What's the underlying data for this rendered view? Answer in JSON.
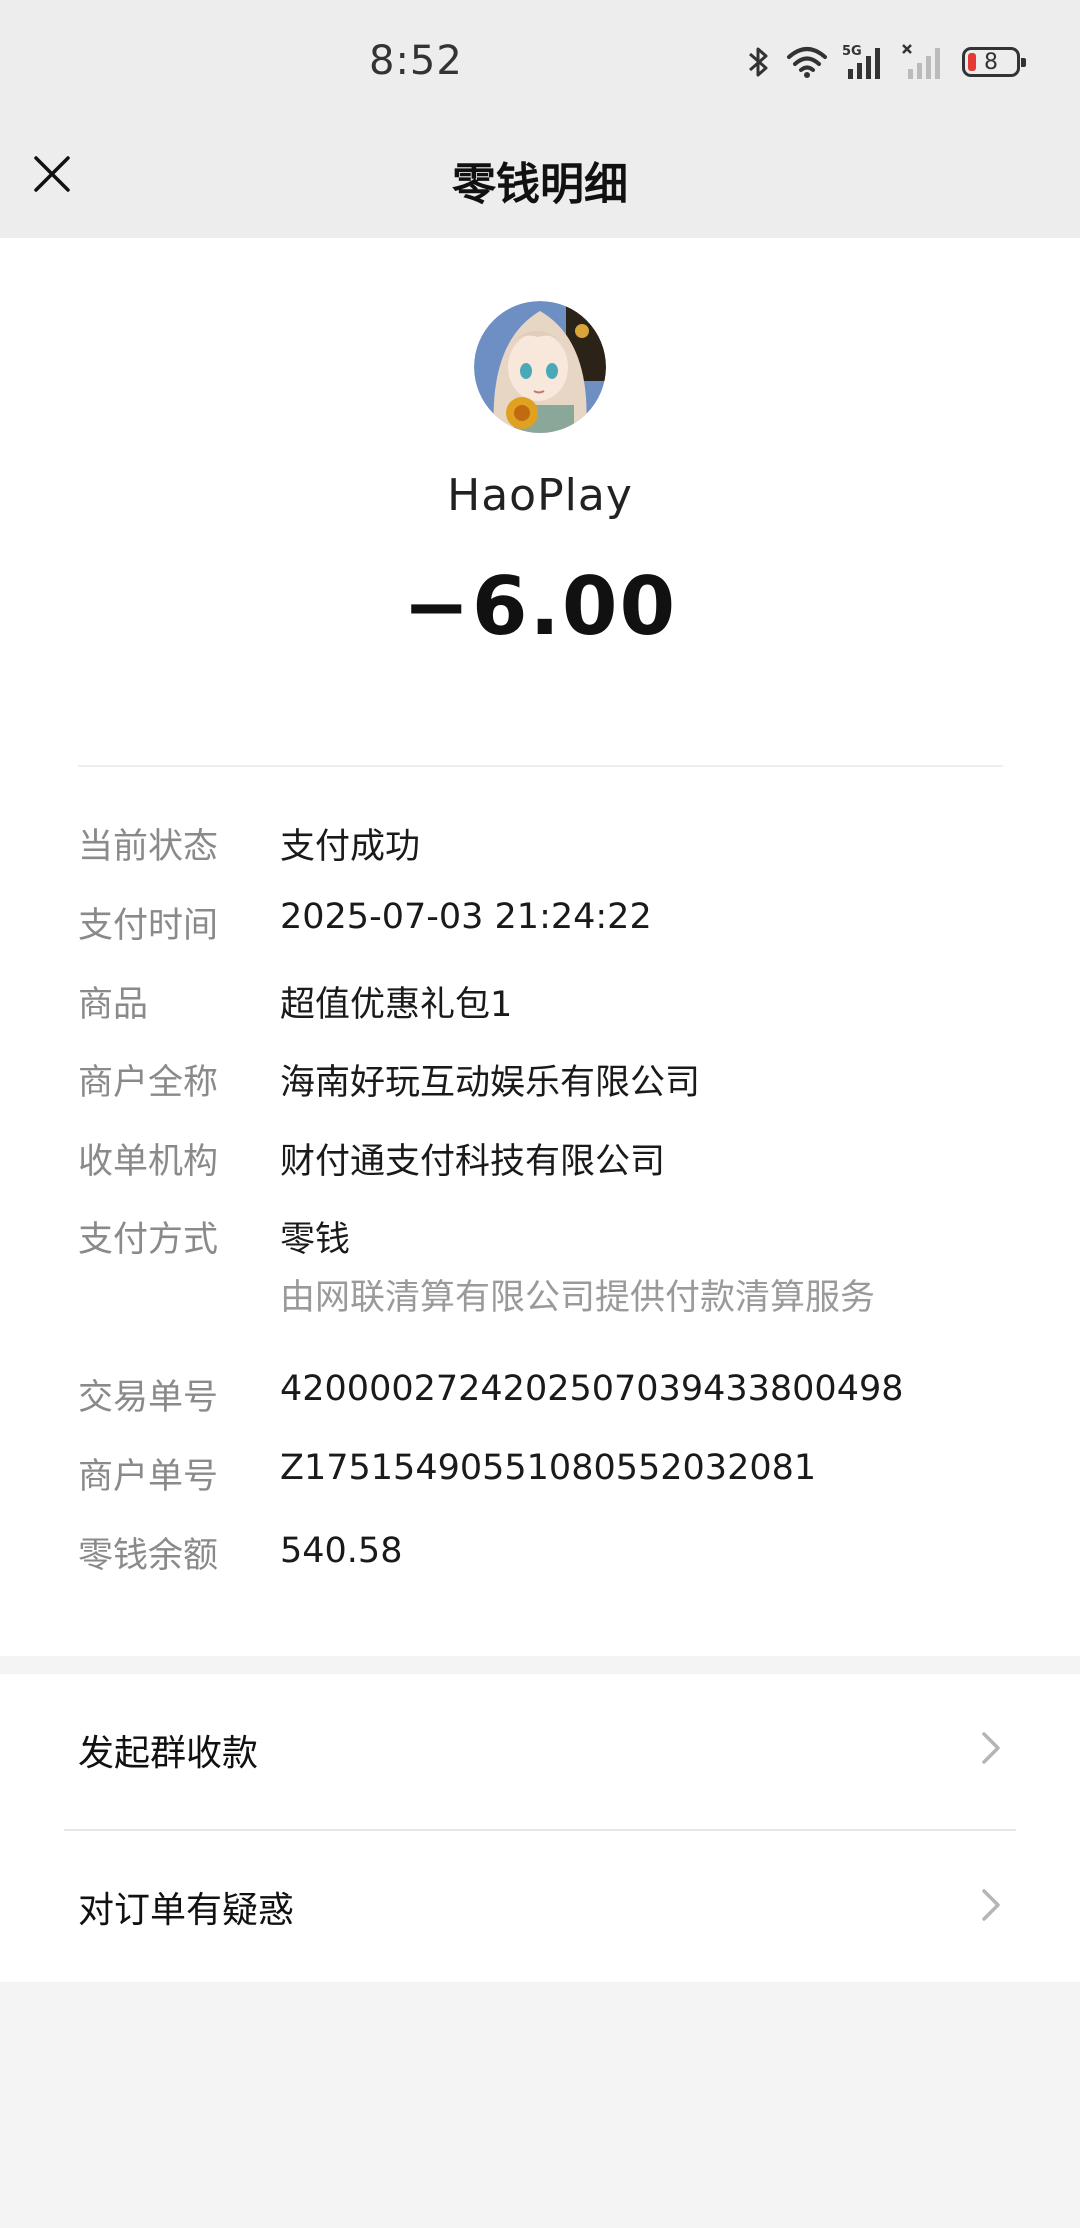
{
  "status_bar": {
    "time": "8:52",
    "network": "5G",
    "battery_level": "8",
    "icons": [
      "bluetooth-icon",
      "wifi-icon",
      "5g-signal-icon",
      "no-signal-icon",
      "battery-icon"
    ]
  },
  "nav": {
    "title": "零钱明细",
    "close_icon": "close-icon"
  },
  "transaction": {
    "merchant_name": "HaoPlay",
    "amount": "−6.00",
    "details": [
      {
        "label": "当前状态",
        "value": "支付成功"
      },
      {
        "label": "支付时间",
        "value": "2025-07-03 21:24:22"
      },
      {
        "label": "商品",
        "value": "超值优惠礼包1"
      },
      {
        "label": "商户全称",
        "value": "海南好玩互动娱乐有限公司"
      },
      {
        "label": "收单机构",
        "value": "财付通支付科技有限公司"
      },
      {
        "label": "支付方式",
        "value": "零钱",
        "sub_value": "由网联清算有限公司提供付款清算服务"
      },
      {
        "label": "交易单号",
        "value": "4200002724202507039433800498"
      },
      {
        "label": "商户单号",
        "value": "Z17515490551080552032081"
      },
      {
        "label": "零钱余额",
        "value": "540.58"
      }
    ]
  },
  "actions": [
    {
      "label": "发起群收款"
    },
    {
      "label": "对订单有疑惑"
    }
  ],
  "colors": {
    "header_bg": "#ededed",
    "page_bg": "#f4f4f4",
    "card_bg": "#ffffff",
    "label_gray": "#8a8a8a",
    "battery_low": "#e53935"
  }
}
